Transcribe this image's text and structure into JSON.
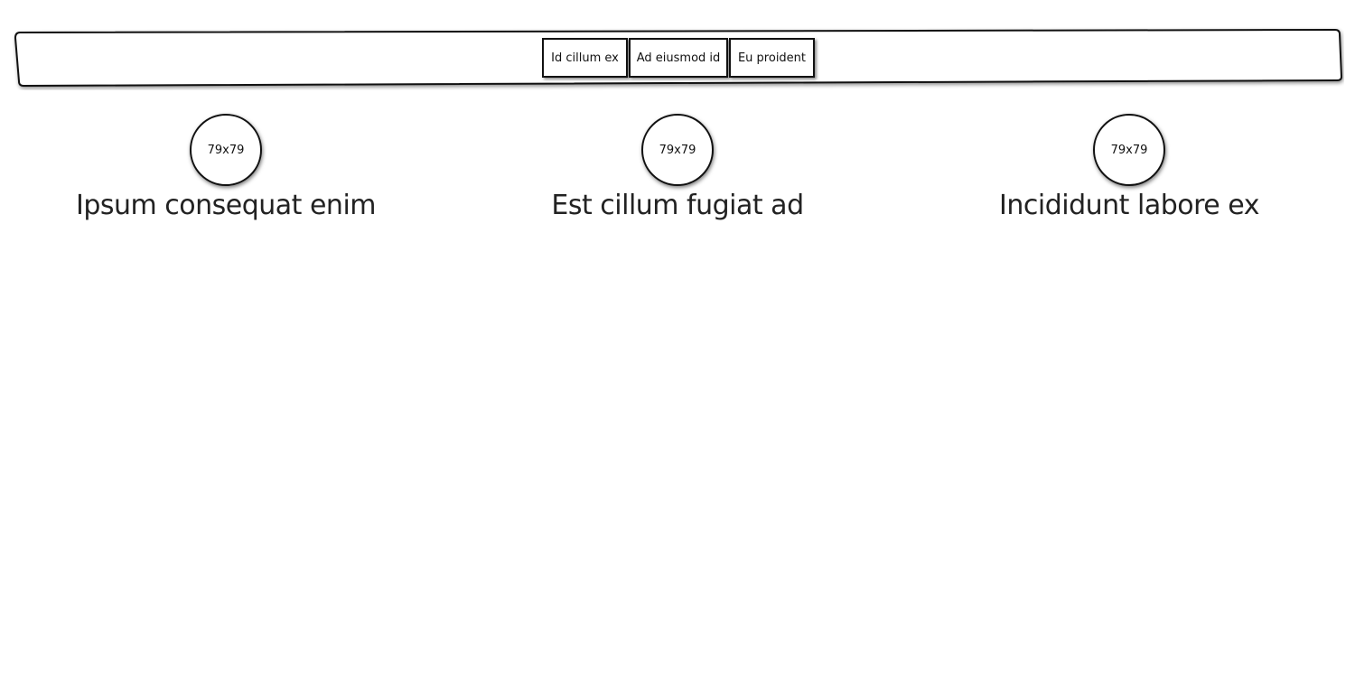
{
  "nav": {
    "items": [
      {
        "label": "Id cillum ex"
      },
      {
        "label": "Ad eiusmod id"
      },
      {
        "label": "Eu proident"
      }
    ]
  },
  "features": [
    {
      "image_label": "79x79",
      "title": "Ipsum consequat enim"
    },
    {
      "image_label": "79x79",
      "title": "Est cillum fugiat ad"
    },
    {
      "image_label": "79x79",
      "title": "Incididunt labore ex"
    }
  ],
  "colors": {
    "ink": "#111111",
    "background": "#ffffff"
  }
}
